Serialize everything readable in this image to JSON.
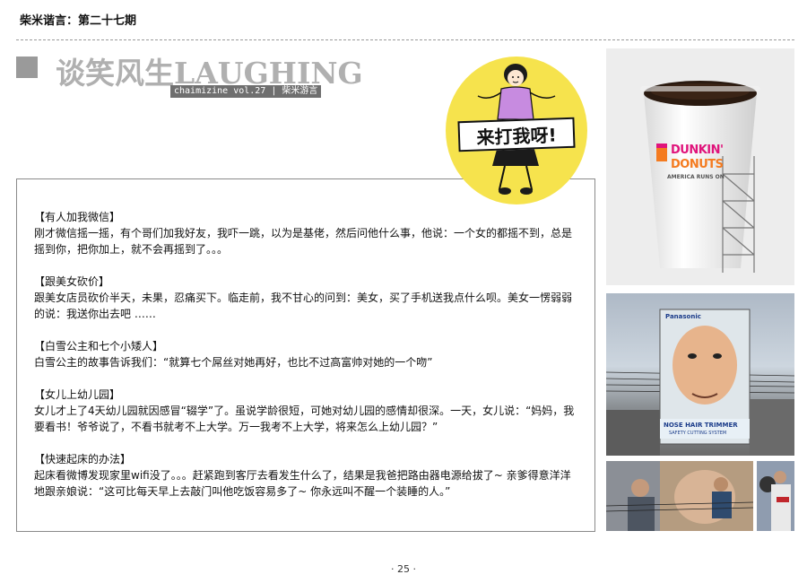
{
  "header": {
    "title": "柴米谐言：第二十七期"
  },
  "section": {
    "title": "谈笑风生LAUGHING",
    "subtitle": "chaimizine vol.27 | 柴米游言"
  },
  "sticker": {
    "caption": "来打我呀!"
  },
  "jokes": [
    {
      "title": "【有人加我微信】",
      "body": "刚才微信摇一摇，有个哥们加我好友，我吓一跳，以为是基佬，然后问他什么事，他说：一个女的都摇不到，总是摇到你，把你加上，就不会再摇到了。。。"
    },
    {
      "title": "【跟美女砍价】",
      "body": "跟美女店员砍价半天，未果，忍痛买下。临走前，我不甘心的问到：美女，买了手机送我点什么呗。美女一愣弱弱的说：我送你出去吧 ……"
    },
    {
      "title": "【白雪公主和七个小矮人】",
      "body": "白雪公主的故事告诉我们：“就算七个屌丝对她再好，也比不过高富帅对她的一个吻”"
    },
    {
      "title": "【女儿上幼儿园】",
      "body": "女儿才上了4天幼儿园就因感冒“辍学”了。虽说学龄很短，可她对幼儿园的感情却很深。一天，女儿说：“妈妈，我要看书！爷爷说了，不看书就考不上大学。万一我考不上大学，将来怎么上幼儿园？”"
    },
    {
      "title": "【快速起床的办法】",
      "body": "起床看微博发现家里wifi没了。。。赶紧跑到客厅去看发生什么了，结果是我爸把路由器电源给拔了~ 亲爹得意洋洋地跟亲娘说：“这可比每天早上去敲门叫他吃饭容易多了~ 你永远叫不醒一个装睡的人。”"
    }
  ],
  "photos": {
    "cup_brand_line1": "DUNKIN'",
    "cup_brand_line2": "DONUTS",
    "cup_tagline": "AMERICA RUNS ON",
    "billboard_brand": "Panasonic",
    "billboard_line1": "NOSE HAIR TRIMMER",
    "billboard_line2": "SAFETY CUTTING SYSTEM"
  },
  "colors": {
    "sticker_yellow": "#f6e34d",
    "sticker_shirt": "#c78be0",
    "dunkin_orange": "#f47b20",
    "dunkin_pink": "#e0147b",
    "title_gray": "#b0b0b0"
  },
  "footer": {
    "page": "· 25 ·"
  }
}
